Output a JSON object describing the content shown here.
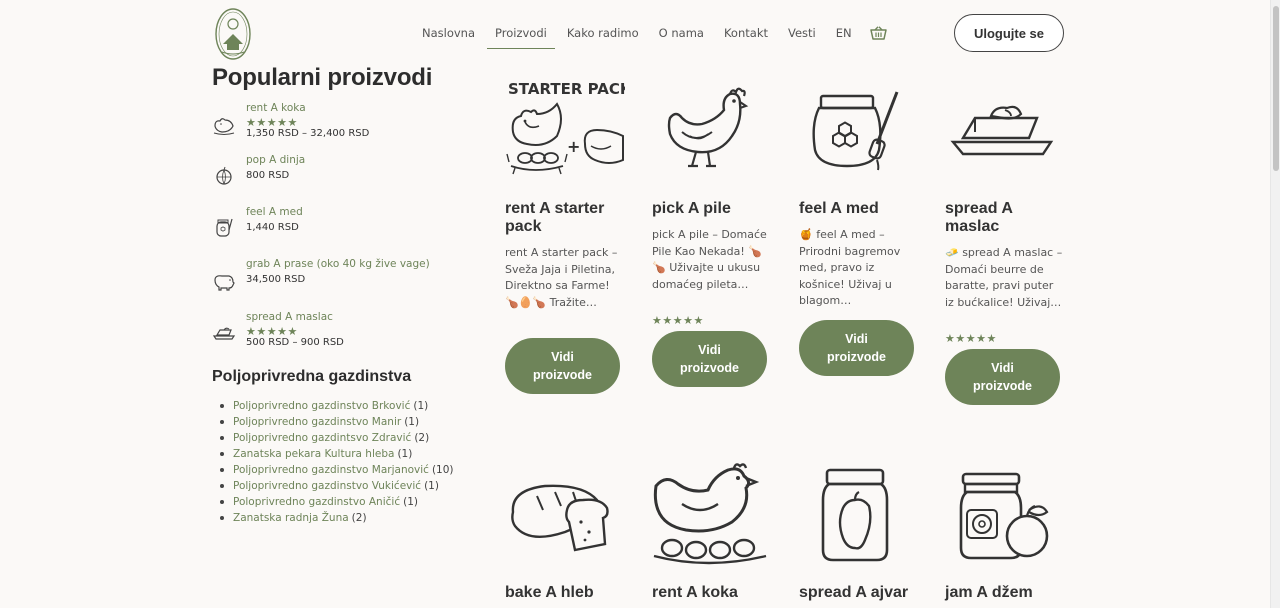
{
  "header": {
    "nav": [
      "Naslovna",
      "Proizvodi",
      "Kako radimo",
      "O nama",
      "Kontakt",
      "Vesti",
      "EN"
    ],
    "active_nav": "Proizvodi",
    "login_label": "Ulogujte se",
    "accent_color": "#6e8459"
  },
  "sidebar": {
    "popular_title": "Popularni proizvodi",
    "popular": [
      {
        "name": "rent A koka",
        "stars": "★★★★★",
        "price": "1,350 RSD – 32,400 RSD",
        "icon": "hen-icon"
      },
      {
        "name": "pop A dinja",
        "stars": "",
        "price": "800 RSD",
        "icon": "melon-icon"
      },
      {
        "name": "feel A med",
        "stars": "",
        "price": "1,440 RSD",
        "icon": "honey-jar-icon"
      },
      {
        "name": "grab A prase (oko 40 kg žive vage)",
        "stars": "",
        "price": "34,500 RSD",
        "icon": "pig-icon"
      },
      {
        "name": "spread A maslac",
        "stars": "★★★★★",
        "price": "500 RSD – 900 RSD",
        "icon": "butter-icon"
      }
    ],
    "farms_title": "Poljoprivredna gazdinstva",
    "farms": [
      {
        "name": "Poljoprivredno gazdinstvo Brković",
        "count": "(1)"
      },
      {
        "name": "Poljoprivredno gazdinstvo Manir",
        "count": "(1)"
      },
      {
        "name": "Poljoprivredno gazdintsvo Zdravić",
        "count": "(2)"
      },
      {
        "name": "Zanatska pekara Kultura hleba",
        "count": "(1)"
      },
      {
        "name": "Poljoprivredno gazdinstvo Marjanović",
        "count": "(10)"
      },
      {
        "name": "Poljoprivredno gazdinstvo Vukićević",
        "count": "(1)"
      },
      {
        "name": "Poloprivredno gazdinstvo Aničić",
        "count": "(1)"
      },
      {
        "name": "Zanatska radnja Žuna",
        "count": "(2)"
      }
    ]
  },
  "products": [
    {
      "title": "rent A starter pack",
      "desc": "rent A starter pack – Sveža Jaja i Piletina, Direktno sa Farme! 🍗🥚🍗 Tražite…",
      "stars": "",
      "button": "Vidi proizvode",
      "image_text": "STARTER PACK",
      "icon": "starter-pack-icon"
    },
    {
      "title": "pick A pile",
      "desc": "pick A pile – Domaće Pile Kao Nekada! 🍗🍗 Uživajte u ukusu domaćeg pileta…",
      "stars": "★★★★★",
      "button": "Vidi proizvode",
      "icon": "hen-icon"
    },
    {
      "title": "feel A med",
      "desc": "🍯 feel A med – Prirodni bagremov med, pravo iz košnice! Uživaj u blagom…",
      "stars": "",
      "button": "Vidi proizvode",
      "icon": "honey-jar-icon"
    },
    {
      "title": "spread A maslac",
      "desc": "🧈 spread A maslac – Domaći beurre de baratte, pravi puter iz bućkalice! Uživaj…",
      "stars": "★★★★★",
      "button": "Vidi proizvode",
      "icon": "butter-icon"
    },
    {
      "title": "bake A hleb",
      "icon": "bread-icon"
    },
    {
      "title": "rent A koka",
      "icon": "nesting-hen-icon"
    },
    {
      "title": "spread A ajvar",
      "icon": "ajvar-jar-icon"
    },
    {
      "title": "jam A džem",
      "icon": "jam-jar-icon"
    }
  ]
}
